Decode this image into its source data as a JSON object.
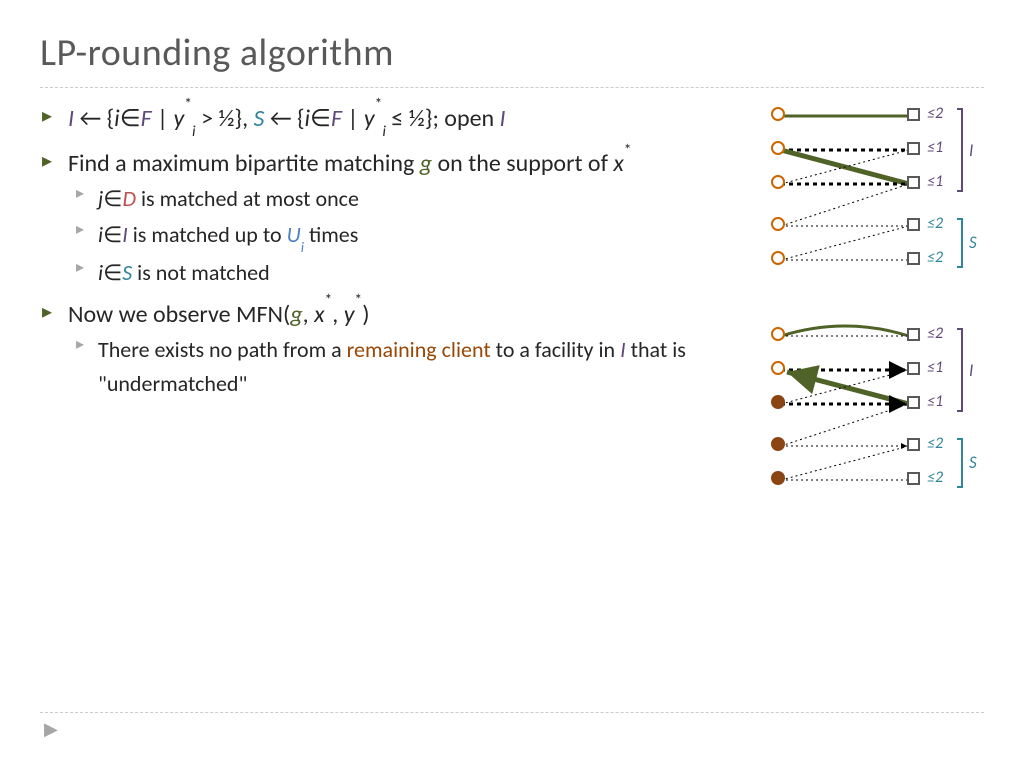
{
  "title": "LP-rounding algorithm",
  "bullets": {
    "b1": {
      "I": "I",
      "arrow": " ← {",
      "i": "i",
      "in": "∈",
      "F": "F",
      "mid": " | ",
      "y": "y",
      "star": "*",
      "sub_i": "i",
      "gt": " > ½}, ",
      "S": "S",
      "arrow2": " ← {",
      "i2": "i",
      "in2": "∈",
      "F2": "F",
      "mid2": " | ",
      "y2": "y",
      "star2": "*",
      "sub_i2": "i",
      "le": " ≤ ½}; open ",
      "Iend": "I"
    },
    "b2": {
      "pre": "Find a maximum bipartite matching ",
      "g": "g",
      "post": " on the support of ",
      "x": "x",
      "star": "*"
    },
    "b2a": {
      "j": "j",
      "in": "∈",
      "D": "D",
      "post": " is matched at most once"
    },
    "b2b": {
      "i": "i",
      "in": "∈",
      "I": "I",
      "mid": " is matched up to ",
      "U": "U",
      "sub": "i",
      "post": " times"
    },
    "b2c": {
      "i": "i",
      "in": "∈",
      "S": "S",
      "post": " is not matched"
    },
    "b3": {
      "pre": "Now we observe MFN(",
      "g": "g",
      "c1": ", ",
      "x": "x",
      "s1": "*",
      "c2": ", ",
      "y": "y",
      "s2": "*",
      "post": ")"
    },
    "b3a": {
      "pre": "There exists no path from a ",
      "rem": "remaining client",
      "mid": " to a facility in ",
      "I": "I",
      "post": " that is \"undermatched\""
    }
  },
  "caps": [
    "≤2",
    "≤1",
    "≤1",
    "≤2",
    "≤2"
  ],
  "labels": {
    "I": "I",
    "S": "S"
  }
}
